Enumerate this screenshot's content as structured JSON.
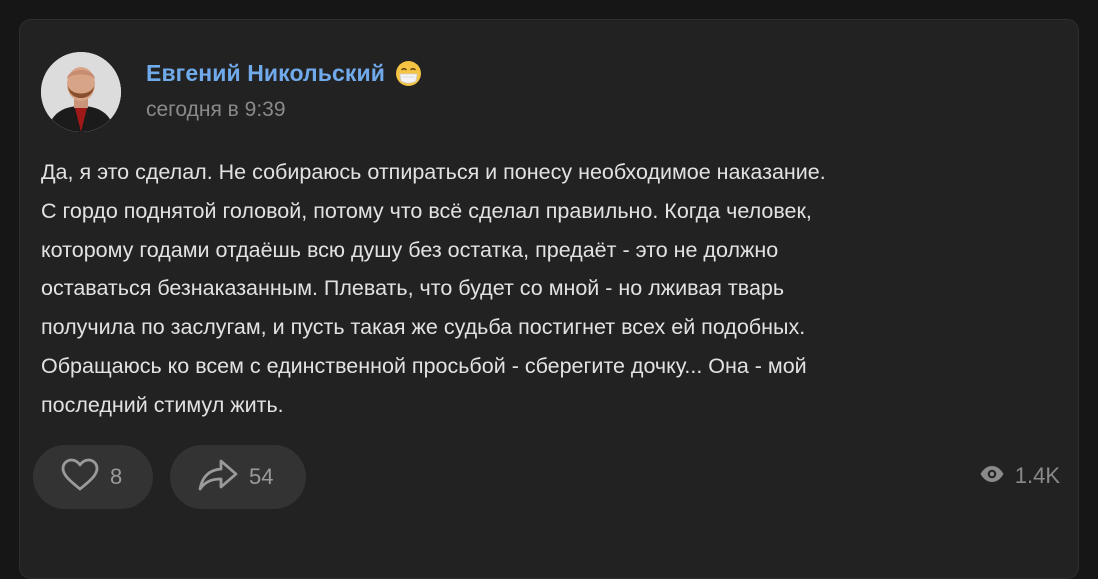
{
  "post": {
    "author": "Евгений Никольский",
    "author_emoji": "face-with-medical-mask-emoji",
    "timestamp": "сегодня в 9:39",
    "text_lines": [
      "Да, я это сделал. Не собираюсь отпираться и понесу необходимое наказание.",
      "С гордо поднятой головой, потому что всё сделал правильно. Когда человек,",
      "которому годами отдаёшь всю душу без остатка, предаёт - это не должно",
      "оставаться безнаказанным. Плевать, что будет со мной - но лживая тварь",
      "получила по заслугам, и пусть такая же судьба постигнет всех ей подобных.",
      "Обращаюсь ко всем с единственной просьбой - сберегите дочку... Она - мой",
      "последний стимул жить."
    ]
  },
  "actions": {
    "likes": "8",
    "shares": "54",
    "views": "1.4K",
    "like_icon": "heart-icon",
    "share_icon": "share-arrow-icon",
    "views_icon": "eye-icon"
  },
  "colors": {
    "page_bg": "#161616",
    "card_bg": "#222222",
    "author_link": "#71aaeb",
    "text": "#e2e2e2",
    "secondary_text": "#8a8a8a",
    "button_bg": "#333333"
  }
}
